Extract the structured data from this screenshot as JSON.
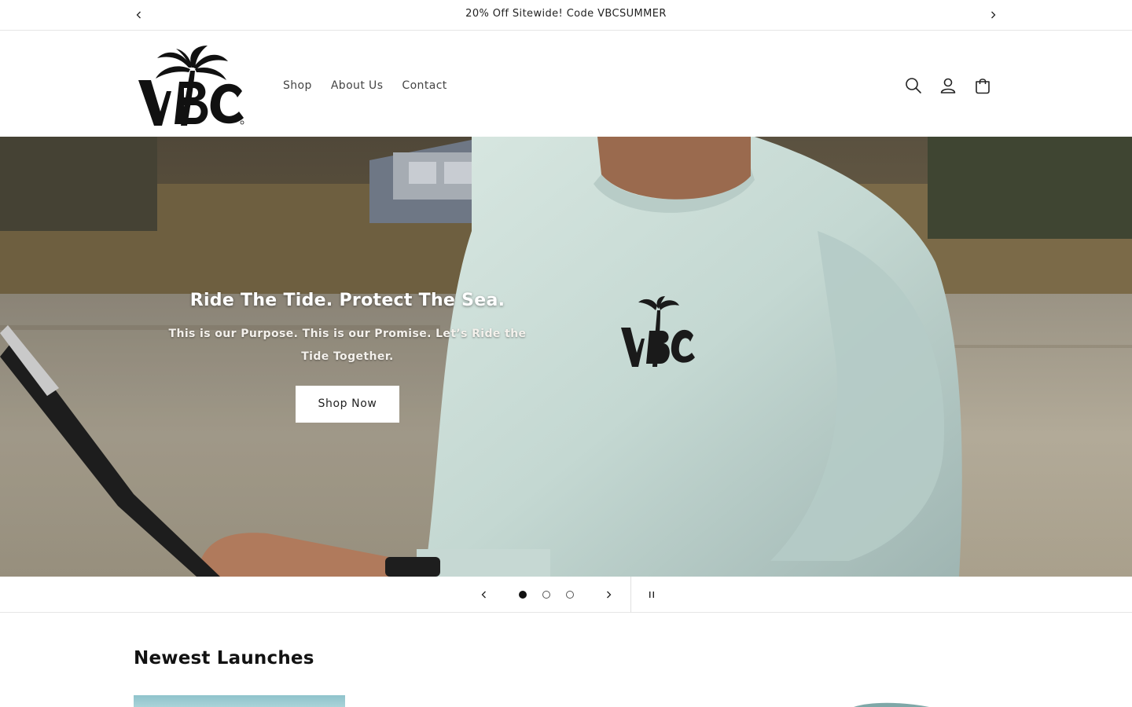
{
  "announcement": {
    "text": "20% Off Sitewide! Code VBCSUMMER",
    "prev_icon": "chevron-left-icon",
    "next_icon": "chevron-right-icon"
  },
  "header": {
    "logo_icon": "vbc-palm-logo",
    "nav": [
      {
        "label": "Shop"
      },
      {
        "label": "About Us"
      },
      {
        "label": "Contact"
      }
    ],
    "icons": [
      "search-icon",
      "account-icon",
      "cart-icon"
    ]
  },
  "hero": {
    "title": "Ride The Tide. Protect The Sea.",
    "subtitle": "This is our Purpose. This is our Promise. Let’s Ride the Tide Together.",
    "button_label": "Shop Now"
  },
  "slideshow": {
    "slide_count": 3,
    "active_slide": 1,
    "prev_icon": "chevron-left-icon",
    "next_icon": "chevron-right-icon",
    "pause_icon": "pause-icon"
  },
  "collection": {
    "title": "Newest Launches"
  },
  "colors": {
    "accent": "#121212",
    "button_bg": "#ffffff",
    "border": "#e6e6e6"
  }
}
